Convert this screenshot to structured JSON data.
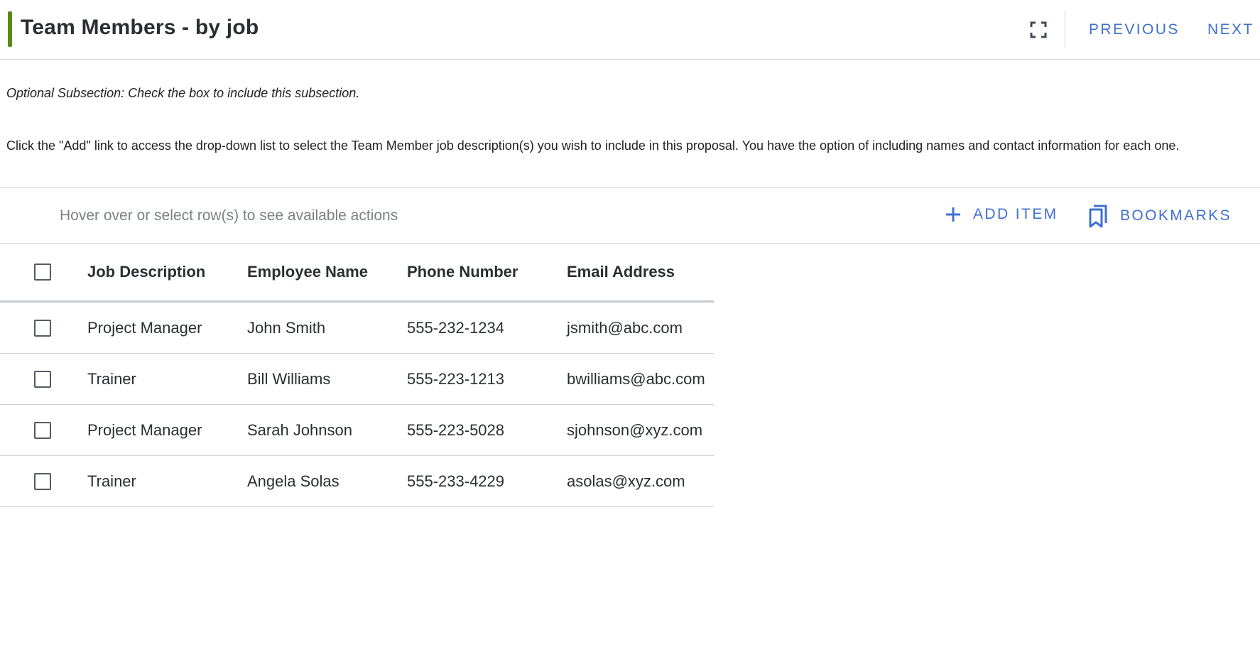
{
  "header": {
    "title": "Team Members - by job",
    "expand_icon": "fullscreen-icon",
    "previous_label": "PREVIOUS",
    "next_label": "NEXT",
    "accent_color": "#5a8a16",
    "link_color": "#3f6fd1"
  },
  "intro": {
    "note": "Optional Subsection: Check the box to include this subsection.",
    "instructions": "Click the \"Add\" link to access the drop-down list to select the Team Member job description(s) you wish to include in this proposal. You have the option of including names and contact information for each one."
  },
  "toolbar": {
    "hint": "Hover over or select row(s) to see available actions",
    "add_item_label": "ADD ITEM",
    "add_icon": "plus-icon",
    "bookmarks_label": "BOOKMARKS",
    "bookmarks_icon": "bookmarks-icon"
  },
  "table": {
    "columns": [
      "Job Description",
      "Employee Name",
      "Phone Number",
      "Email Address"
    ],
    "rows": [
      {
        "job": "Project Manager",
        "name": "John Smith",
        "phone": "555-232-1234",
        "email": "jsmith@abc.com"
      },
      {
        "job": "Trainer",
        "name": "Bill Williams",
        "phone": "555-223-1213",
        "email": "bwilliams@abc.com"
      },
      {
        "job": "Project Manager",
        "name": "Sarah Johnson",
        "phone": "555-223-5028",
        "email": "sjohnson@xyz.com"
      },
      {
        "job": "Trainer",
        "name": "Angela Solas",
        "phone": "555-233-4229",
        "email": "asolas@xyz.com"
      }
    ]
  }
}
